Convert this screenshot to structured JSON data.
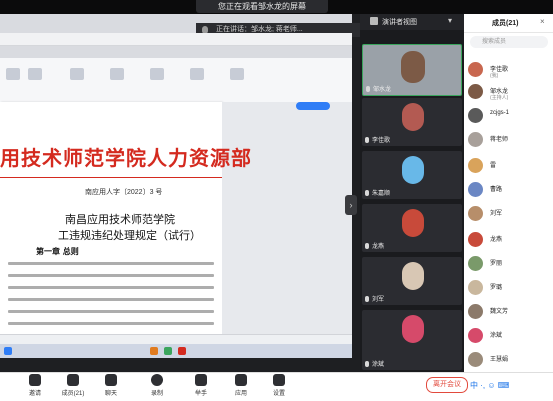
{
  "banner": {
    "text": "您正在观看邹水龙的屏幕"
  },
  "speaking": {
    "text": "正在讲话：邹水龙; 蒋老师..."
  },
  "gallery": {
    "view_label": "演讲者视图",
    "tiles": [
      {
        "name": "邹水龙"
      },
      {
        "name": "李佳歌"
      },
      {
        "name": "朱嘉顺"
      },
      {
        "name": "龙燕"
      },
      {
        "name": "刘军"
      },
      {
        "name": "涂斌"
      }
    ]
  },
  "participants": {
    "title": "成员(21)",
    "search_placeholder": "搜索成员",
    "list": [
      {
        "name": "李佳歌",
        "sub": "(我)"
      },
      {
        "name": "邹水龙",
        "sub": "(主持人)"
      },
      {
        "name": "zcjgs-1",
        "sub": ""
      },
      {
        "name": "蒋老师",
        "sub": ""
      },
      {
        "name": "雷",
        "sub": ""
      },
      {
        "name": "曹路",
        "sub": ""
      },
      {
        "name": "刘军",
        "sub": ""
      },
      {
        "name": "龙燕",
        "sub": ""
      },
      {
        "name": "罗丽",
        "sub": ""
      },
      {
        "name": "罗璐",
        "sub": ""
      },
      {
        "name": "魏文芳",
        "sub": ""
      },
      {
        "name": "涂斌",
        "sub": ""
      },
      {
        "name": "王慧娟",
        "sub": ""
      }
    ]
  },
  "document": {
    "org_title": "用技术师范学院人力资源部",
    "doc_number": "南应用人字〔2022〕3 号",
    "subtitle_1": "南昌应用技术师范学院",
    "subtitle_2": "工违规违纪处理规定（试行）",
    "chapter": "第一章   总则"
  },
  "toolbar": {
    "items": [
      {
        "label": "邀请"
      },
      {
        "label": "成员(21)"
      },
      {
        "label": "聊天"
      },
      {
        "label": "录制"
      },
      {
        "label": "举手"
      },
      {
        "label": "应用"
      },
      {
        "label": "设置"
      }
    ],
    "leave_label": "离开会议"
  },
  "ime": {
    "text": "中 ·, ☺ ⌨"
  },
  "colors": {
    "accent": "#2f7df6",
    "leave": "#e24a3d",
    "title_red": "#d42a1f",
    "active_border": "#3aa55d"
  }
}
